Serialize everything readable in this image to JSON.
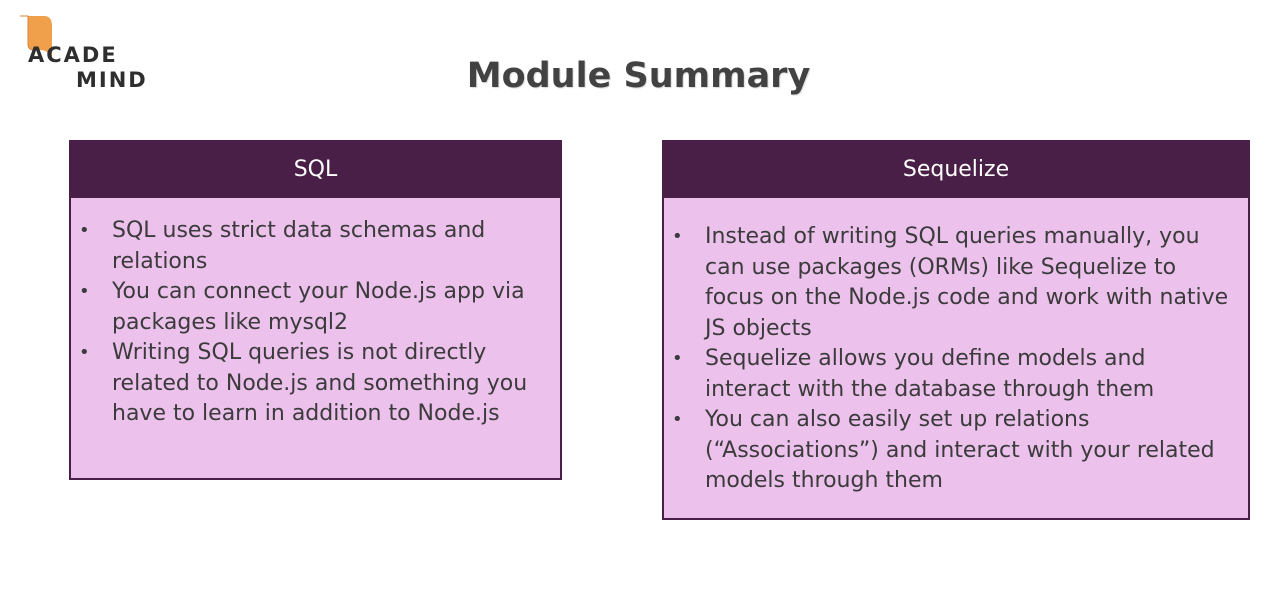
{
  "logo": {
    "line1": "ACADE",
    "line2": "MIND",
    "accent_color": "#f0a04b"
  },
  "title": "Module Summary",
  "colors": {
    "header_bg": "#4a1f47",
    "card_bg": "#ecc1ec"
  },
  "cards": [
    {
      "heading": "SQL",
      "bullets": [
        "SQL uses strict data schemas and relations",
        "You can connect your Node.js app via packages like mysql2",
        "Writing SQL queries is not directly related to Node.js and something you have to learn in addition to Node.js"
      ]
    },
    {
      "heading": "Sequelize",
      "bullets": [
        "Instead of writing SQL queries manually, you can use packages (ORMs) like Sequelize to focus on the Node.js code and work with native JS objects",
        "Sequelize allows you define models and interact with the database through them",
        "You can also easily set up relations (“Associations”) and interact with your related models through them"
      ]
    }
  ]
}
